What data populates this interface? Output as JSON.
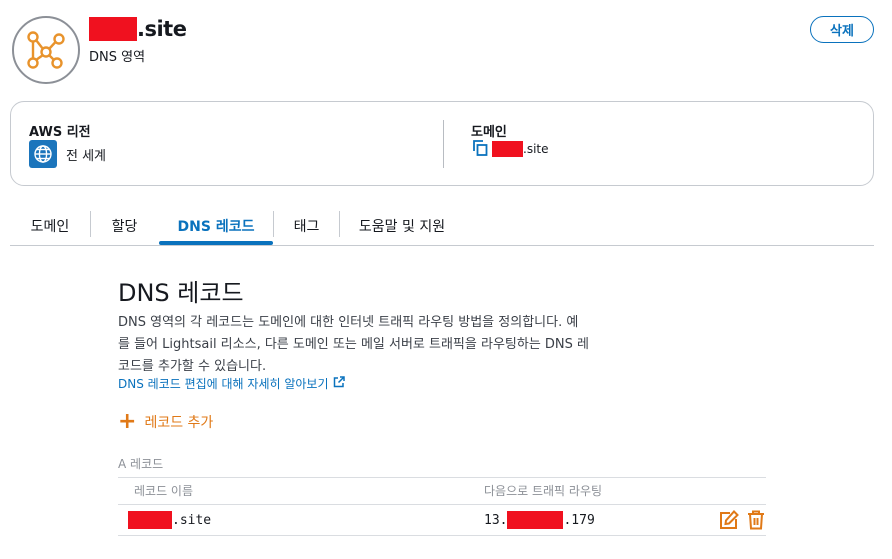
{
  "header": {
    "title_suffix": ".site",
    "subtitle": "DNS 영역",
    "delete_label": "삭제"
  },
  "info": {
    "region_label": "AWS 리전",
    "region_value": "전 세계",
    "domain_label": "도메인",
    "domain_suffix": ".site"
  },
  "tabs": [
    {
      "label": "도메인",
      "active": false
    },
    {
      "label": "할당",
      "active": false
    },
    {
      "label": "DNS 레코드",
      "active": true
    },
    {
      "label": "태그",
      "active": false
    },
    {
      "label": "도움말 및 지원",
      "active": false
    }
  ],
  "content": {
    "title": "DNS 레코드",
    "desc_line1": "DNS 영역의 각 레코드는 도메인에 대한 인터넷 트래픽 라우팅 방법을 정의합니다. 예",
    "desc_line2": "를 들어 Lightsail 리소스, 다른 도메인 또는 메일 서버로 트래픽을 라우팅하는 DNS 레",
    "desc_line3": "코드를 추가할 수 있습니다.",
    "learn_link": "DNS 레코드 편집에 대해 자세히 알아보기",
    "add_record": "레코드 추가"
  },
  "records": {
    "section_label": "A 레코드",
    "columns": [
      "레코드 이름",
      "다음으로 트래픽 라우팅"
    ],
    "rows": [
      {
        "name_suffix": ".site",
        "ip_prefix": "13.",
        "ip_suffix": ".179"
      }
    ]
  },
  "colors": {
    "accent_blue": "#0a72bd",
    "accent_orange": "#e07917",
    "redaction": "#f0111f"
  },
  "icons": {
    "avatar": "dns-zone-icon",
    "region": "globe-icon",
    "copy": "copy-icon",
    "external": "external-link-icon",
    "edit": "edit-icon",
    "delete": "trash-icon"
  }
}
